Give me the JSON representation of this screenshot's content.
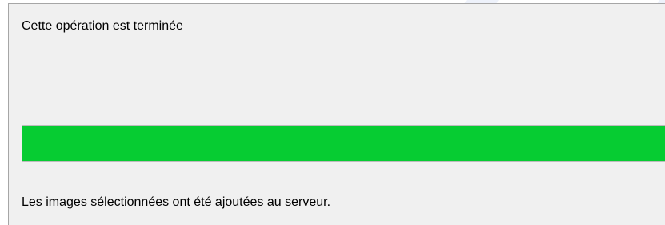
{
  "dialog": {
    "status_title": "Cette opération est terminée",
    "progress": {
      "percent": 100,
      "fill_color": "#06cc32"
    },
    "status_message": "Les images sélectionnées ont été ajoutées au serveur."
  }
}
